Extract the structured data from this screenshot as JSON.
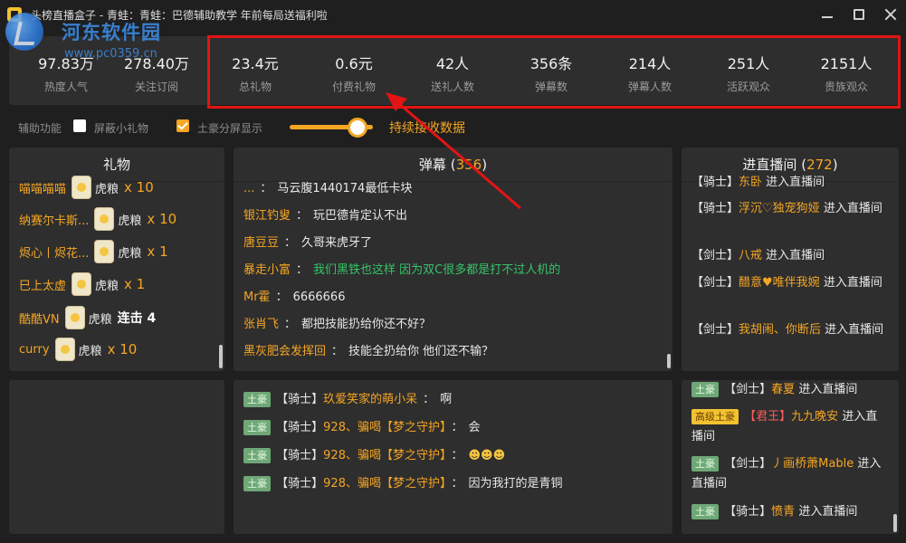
{
  "window": {
    "title": "头榜直播盒子 - 青蛙：青蛙：巴德辅助教学 年前每局送福利啦",
    "minimize": "minimize-icon",
    "maximize": "maximize-icon",
    "close": "close-icon"
  },
  "watermark": {
    "title": "河东软件园",
    "url": "www.pc0359.cn"
  },
  "stats": [
    {
      "value": "97.83万",
      "label": "热度人气"
    },
    {
      "value": "278.40万",
      "label": "关注订阅"
    },
    {
      "value": "23.4元",
      "label": "总礼物"
    },
    {
      "value": "0.6元",
      "label": "付费礼物"
    },
    {
      "value": "42人",
      "label": "送礼人数"
    },
    {
      "value": "356条",
      "label": "弹幕数"
    },
    {
      "value": "214人",
      "label": "弹幕人数"
    },
    {
      "value": "251人",
      "label": "活跃观众"
    },
    {
      "value": "2151人",
      "label": "贵族观众"
    }
  ],
  "controls": {
    "assist_label": "辅助功能",
    "block_small_gift": {
      "label": "屏蔽小礼物",
      "checked": false
    },
    "tuhao_split": {
      "label": "土豪分屏显示",
      "checked": true
    },
    "slider_label": "持续接收数据",
    "slider_level": 0.82
  },
  "gift_panel": {
    "title": "礼物",
    "items": [
      {
        "user": "喵喵喵喵",
        "gift": "虎粮",
        "qty": "x 10"
      },
      {
        "user": "纳赛尔卡斯...",
        "gift": "虎粮",
        "qty": "x 10"
      },
      {
        "user": "烬心丨烬花...",
        "gift": "虎粮",
        "qty": "x 1"
      },
      {
        "user": "巳上太虚",
        "gift": "虎粮",
        "qty": "x 1"
      },
      {
        "user": "酷酷VN",
        "gift": "虎粮",
        "combo": "连击 4"
      },
      {
        "user": "curry",
        "gift": "虎粮",
        "qty": "x 10"
      }
    ]
  },
  "danmu_panel": {
    "title": "弹幕",
    "count": "356",
    "items": [
      {
        "user": "...",
        "text": "马云腹1440174最低卡块",
        "green": false
      },
      {
        "user": "银江钓叟",
        "text": "玩巴德肯定认不出",
        "green": false
      },
      {
        "user": "唐豆豆",
        "text": "久哥来虎牙了",
        "green": false
      },
      {
        "user": "暴走小富",
        "text": "我们黑铁也这样 因为双C很多都是打不过人机的",
        "green": true
      },
      {
        "user": "Mr霍",
        "text": "6666666",
        "green": false
      },
      {
        "user": "张肖飞",
        "text": "都把技能扔给你还不好？",
        "green": false
      },
      {
        "user": "黑灰肥会发挥回",
        "text": "技能全扔给你 他们还不输？",
        "green": false
      }
    ],
    "tuhao_items": [
      {
        "badge": "土豪",
        "tag": "【骑士】",
        "user": "玖爱笑家的萌小呆",
        "text": "啊"
      },
      {
        "badge": "土豪",
        "tag": "【骑士】",
        "user": "928、骗喝【梦之守护】",
        "text": "会"
      },
      {
        "badge": "土豪",
        "tag": "【骑士】",
        "user": "928、骗喝【梦之守护】",
        "text": "",
        "emoji": "smile-emoji"
      },
      {
        "badge": "土豪",
        "tag": "【骑士】",
        "user": "928、骗喝【梦之守护】",
        "text": "因为我打的是青铜"
      }
    ]
  },
  "enter_panel": {
    "title": "进直播间",
    "count": "272",
    "suffix": "进入直播间",
    "items": [
      {
        "tag": "【骑士】",
        "user": "东卧",
        "badge": ""
      },
      {
        "tag": "【骑士】",
        "user": "浮沉♡独宠狗娅",
        "badge": ""
      },
      {
        "tag": "【剑士】",
        "user": "八戒",
        "badge": ""
      },
      {
        "tag": "【剑士】",
        "user": "醋意♥唯伴我婉",
        "badge": ""
      },
      {
        "tag": "【剑士】",
        "user": "我胡闹、你断后",
        "badge": ""
      }
    ],
    "tuhao_items": [
      {
        "badge": "土豪",
        "tag": "【剑士】",
        "user": "春夏"
      },
      {
        "badge": "高级土豪",
        "tag": "【君王】",
        "user": "九九晚安"
      },
      {
        "badge": "土豪",
        "tag": "【剑士】",
        "user": "丿画桥萧Mable"
      },
      {
        "badge": "土豪",
        "tag": "【骑士】",
        "user": "愤青"
      }
    ]
  },
  "colors": {
    "accent": "#f5a623",
    "highlight_box": "#e21414",
    "panel_bg": "#2e2e2e",
    "window_bg": "#1f1f1f",
    "green_text": "#35c46a"
  }
}
